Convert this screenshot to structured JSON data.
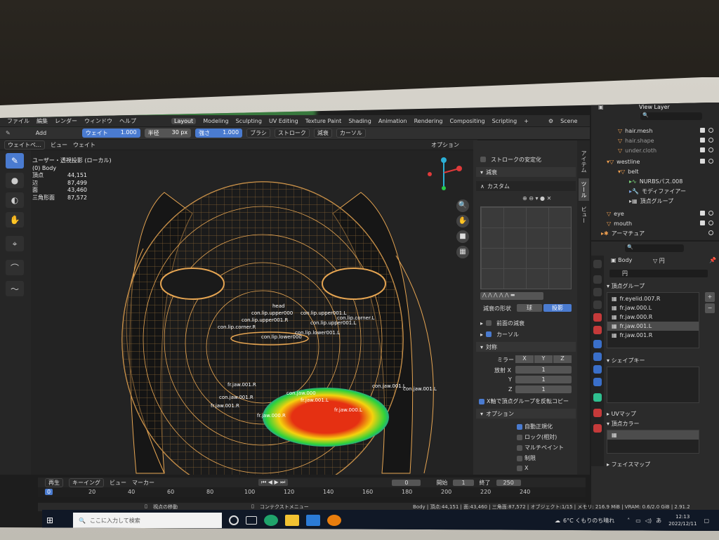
{
  "blender": {
    "menu": [
      "ファイル",
      "編集",
      "レンダー",
      "ウィンドウ",
      "ヘルプ"
    ],
    "workspaces": [
      "Layout",
      "Modeling",
      "Sculpting",
      "UV Editing",
      "Texture Paint",
      "Shading",
      "Animation",
      "Rendering",
      "Compositing",
      "Scripting"
    ],
    "active_workspace": "Layout",
    "scene": "Scene",
    "view_layer": "View Layer",
    "toolbar": {
      "brush_name": "Add",
      "weight_label": "ウェイト",
      "weight_value": "1.000",
      "radius_label": "半径",
      "radius_value": "30 px",
      "strength_label": "強さ",
      "strength_value": "1.000",
      "brush_menu": "ブラシ",
      "stroke_menu": "ストローク",
      "falloff_menu": "減衰",
      "cursor_menu": "カーソル",
      "options_menu": "オプション"
    },
    "header2": {
      "mode": "ウェイトペ…",
      "view": "ビュー",
      "weight": "ウェイト"
    },
    "viewport_info": {
      "title": "ユーザー・透視投影 (ローカル)",
      "object": "(0) Body",
      "stats": [
        {
          "label": "頂点",
          "value": "44,151"
        },
        {
          "label": "辺",
          "value": "87,499"
        },
        {
          "label": "面",
          "value": "43,460"
        },
        {
          "label": "三角形面",
          "value": "87,572"
        }
      ]
    },
    "bone_labels": {
      "head": "head",
      "l1": "con.lip.upper000",
      "l2": "con.lip.upper001.L",
      "l3": "con.lip.upper001.L",
      "l4": "con.lip.corner.L",
      "l5": "con.lip.corner.R",
      "l6": "con.lip.upper001.R",
      "l7": "con.lip.lower001.L",
      "l8": "con.lip.lower000",
      "l9": "con.jaw.001.L",
      "l10": "con.jaw.001.R",
      "l11": "fr.jaw.001.R",
      "l12": "con.jaw.000",
      "l13": "con.jaw.001.L",
      "l14": "fr.jaw.000.R",
      "l15": "fr.jaw.000.L",
      "l16": "fr.jaw.001.L",
      "l17": "fr.jaw.001.R"
    },
    "tool_panel": {
      "stroke_stabilize": "ストロークの安定化",
      "falloff": "減衰",
      "custom": "カスタム",
      "falloff_shape": "減衰の形状",
      "sphere": "球",
      "projected": "投影",
      "front_falloff": "前面の減衰",
      "cursor": "カーソル",
      "symmetry": "対称",
      "mirror": "ミラー",
      "axes": [
        "X",
        "Y",
        "Z"
      ],
      "radial": "放射 X",
      "radial_y": "Y",
      "radial_z": "Z",
      "radial_values": [
        "1",
        "1",
        "1"
      ],
      "x_mirror_groups": "X軸で頂点グループを反転コピー",
      "options": "オプション",
      "auto_normalize": "自動正規化",
      "lock_relative": "ロック(相対)",
      "multi_paint": "マルチペイント",
      "restrict": "制限",
      "x": "X",
      "tab_item": "アイテム",
      "tab_tool": "ツール",
      "tab_view": "ビュー"
    },
    "outliner": [
      {
        "name": "hair.mesh",
        "level": 2
      },
      {
        "name": "hair.shape",
        "level": 2
      },
      {
        "name": "under.cloth",
        "level": 2
      },
      {
        "name": "westline",
        "level": 1
      },
      {
        "name": "belt",
        "level": 2
      },
      {
        "name": "NURBSパス.008",
        "level": 3
      },
      {
        "name": "モディファイアー",
        "level": 3
      },
      {
        "name": "頂点グループ",
        "level": 3
      },
      {
        "name": "eye",
        "level": 1
      },
      {
        "name": "mouth",
        "level": 1
      },
      {
        "name": "アーマチュア",
        "level": 1
      }
    ],
    "data_props": {
      "object": "Body",
      "mesh": "円",
      "mesh_field": "円",
      "vertex_groups_title": "頂点グループ",
      "vertex_groups": [
        "fr.eyelid.007.R",
        "fr.jaw.000.L",
        "fr.jaw.000.R",
        "fr.jaw.001.L",
        "fr.jaw.001.R"
      ],
      "selected_group": "fr.jaw.001.L",
      "shape_keys": "シェイプキー",
      "uv_maps": "UVマップ",
      "vertex_colors": "頂点カラー",
      "face_maps": "フェイスマップ"
    },
    "timeline": {
      "playback": "再生",
      "keying": "キーイング",
      "view": "ビュー",
      "marker": "マーカー",
      "current_frame": "0",
      "start_label": "開始",
      "start": "1",
      "end_label": "終了",
      "end": "250",
      "ticks": [
        "0",
        "20",
        "40",
        "60",
        "80",
        "100",
        "120",
        "140",
        "160",
        "180",
        "200",
        "220",
        "240"
      ]
    },
    "status": {
      "move_view": "視点の移動",
      "context_menu": "コンテクストメニュー",
      "info": "Body | 頂点:44,151 | 面:43,460 | 三角面:87,572 | オブジェクト:1/15 | メモリ: 216.9 MiB | VRAM: 0.6/2.0 GiB | 2.91.2"
    }
  },
  "taskbar": {
    "search_placeholder": "ここに入力して検索",
    "weather": "6°C くもりのち晴れ",
    "time": "12:13",
    "date": "2022/12/11"
  },
  "colors": {
    "accent": "#4a7bd0",
    "wire": "#e6a552",
    "heat_red": "#e53012",
    "heat_green": "#2fd23a",
    "heat_blue": "#1e6aff"
  }
}
